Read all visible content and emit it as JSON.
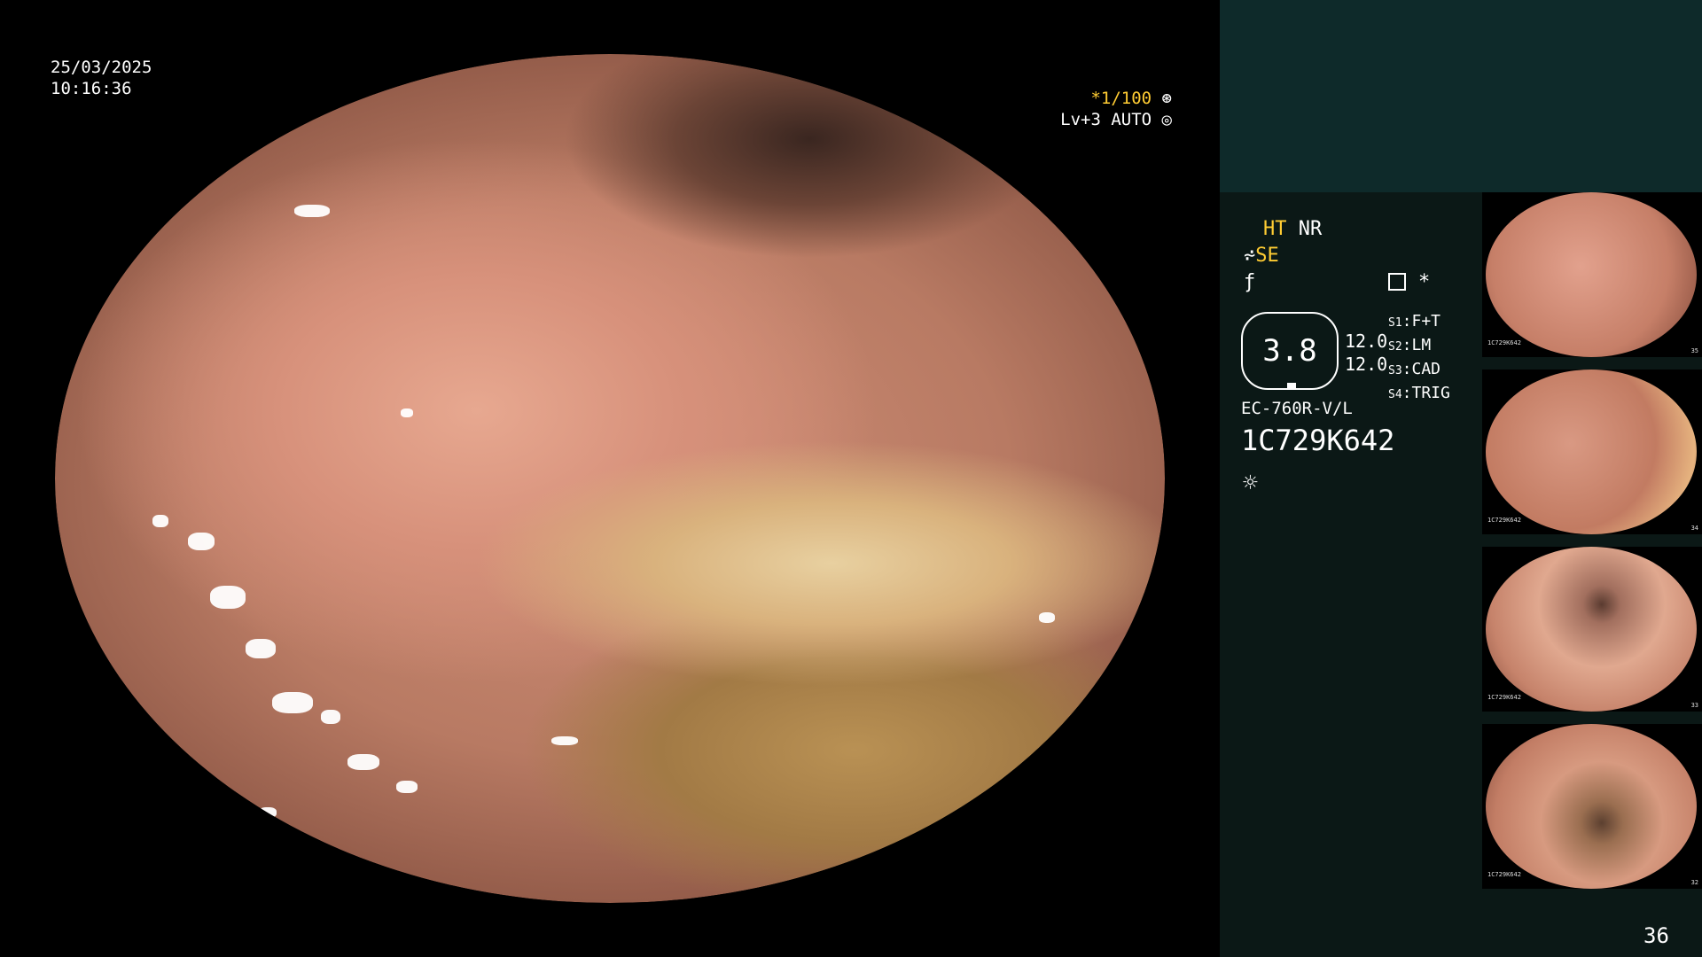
{
  "overlay": {
    "date": "25/03/2025",
    "time": "10:16:36",
    "shutter": "*1/100",
    "shutter_icon": "aperture-icon",
    "level": "Lv+3 AUTO",
    "level_icon": "target-icon"
  },
  "panel": {
    "ht": "HT",
    "nr": "NR",
    "se": "SE",
    "f_symbol": "⁀",
    "asterisk": "*",
    "zoom_value": "3.8",
    "setting_1": "12.0",
    "setting_2": "12.0",
    "switches": [
      {
        "key": "S1",
        "value": "F+T"
      },
      {
        "key": "S2",
        "value": "LM"
      },
      {
        "key": "S3",
        "value": "CAD"
      },
      {
        "key": "S4",
        "value": "TRIG"
      }
    ],
    "scope_model": "EC-760R-V/L",
    "scope_serial": "1C729K642",
    "light_icon": "sun-icon",
    "frame_count": "36"
  },
  "thumbnails": [
    {
      "id": "1C729K642",
      "num": "35"
    },
    {
      "id": "1C729K642",
      "num": "34"
    },
    {
      "id": "1C729K642",
      "num": "33"
    },
    {
      "id": "1C729K642",
      "num": "32"
    }
  ],
  "colors": {
    "highlight": "#ffcc33",
    "panel_top": "#0e2a2a",
    "panel_bottom": "#0b1816"
  }
}
